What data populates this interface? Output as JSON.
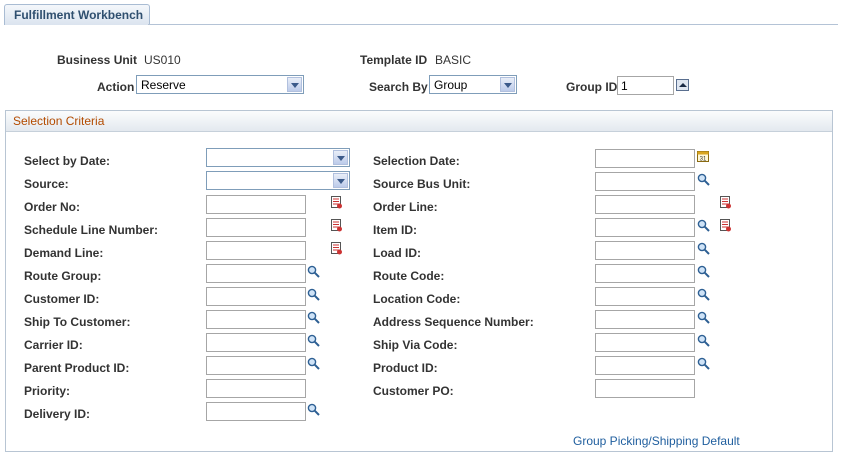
{
  "tab": {
    "label": "Fulfillment Workbench"
  },
  "header": {
    "business_unit_label": "Business Unit",
    "business_unit_value": "US010",
    "template_id_label": "Template ID",
    "template_id_value": "BASIC",
    "action_label": "Action",
    "action_value": "Reserve",
    "search_by_label": "Search By",
    "search_by_value": "Group",
    "group_id_label": "Group ID",
    "group_id_value": "1"
  },
  "selection": {
    "title": "Selection Criteria",
    "left": [
      {
        "label": "Select by Date:"
      },
      {
        "label": "Source:"
      },
      {
        "label": "Order No:"
      },
      {
        "label": "Schedule Line Number:"
      },
      {
        "label": "Demand Line:"
      },
      {
        "label": "Route Group:"
      },
      {
        "label": "Customer ID:"
      },
      {
        "label": "Ship To Customer:"
      },
      {
        "label": "Carrier ID:"
      },
      {
        "label": "Parent Product ID:"
      },
      {
        "label": "Priority:"
      },
      {
        "label": "Delivery ID:"
      }
    ],
    "right": [
      {
        "label": "Selection Date:"
      },
      {
        "label": "Source Bus Unit:"
      },
      {
        "label": "Order Line:"
      },
      {
        "label": "Item ID:"
      },
      {
        "label": "Load ID:"
      },
      {
        "label": "Route Code:"
      },
      {
        "label": "Location Code:"
      },
      {
        "label": "Address Sequence Number:"
      },
      {
        "label": "Ship Via Code:"
      },
      {
        "label": "Product ID:"
      },
      {
        "label": "Customer PO:"
      }
    ],
    "link": "Group Picking/Shipping Default"
  },
  "icons": {
    "lookup": "magnifier-icon",
    "prompt_list": "prompt-list-icon",
    "calendar": "calendar-icon",
    "calendar_day": "31"
  },
  "colors": {
    "accent": "#1f5e9e",
    "group_title": "#b34b00"
  }
}
